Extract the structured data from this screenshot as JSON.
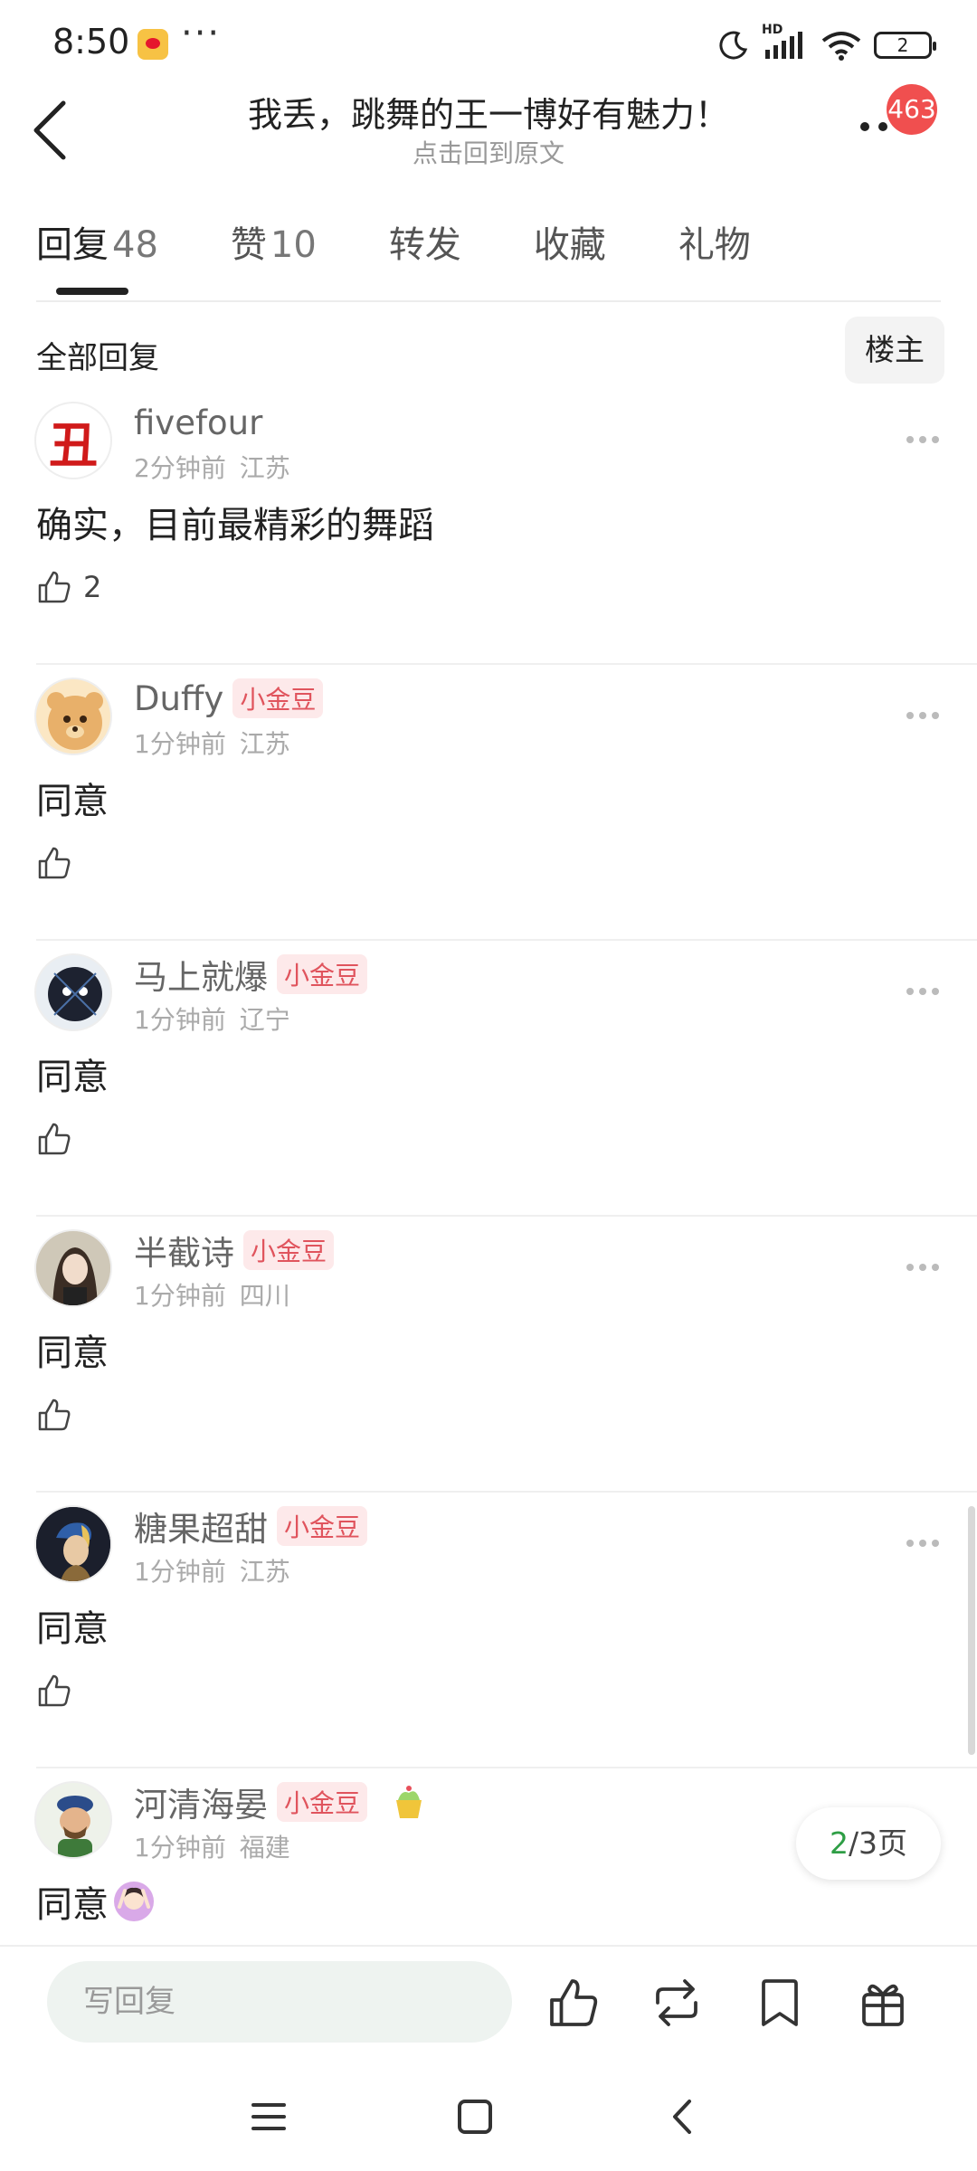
{
  "status_bar": {
    "time": "8:50",
    "more": "···",
    "battery_level": "2",
    "network": "HD"
  },
  "header": {
    "title": "我丢，跳舞的王一博好有魅力！",
    "subtitle": "点击回到原文",
    "notification_count": "463"
  },
  "tabs": [
    {
      "label": "回复",
      "count": "48",
      "active": true
    },
    {
      "label": "赞",
      "count": "10",
      "active": false
    },
    {
      "label": "转发",
      "count": "",
      "active": false
    },
    {
      "label": "收藏",
      "count": "",
      "active": false
    },
    {
      "label": "礼物",
      "count": "",
      "active": false
    }
  ],
  "filter": {
    "label": "全部回复",
    "owner_button": "楼主"
  },
  "comments": [
    {
      "user": "fivefour",
      "badge": "",
      "time": "2分钟前",
      "location": "江苏",
      "text": "确实，目前最精彩的舞蹈",
      "likes": "2",
      "avatar": "char-avatar"
    },
    {
      "user": "Duffy",
      "badge": "小金豆",
      "time": "1分钟前",
      "location": "江苏",
      "text": "同意",
      "likes": "",
      "avatar": "bear-avatar"
    },
    {
      "user": "马上就爆",
      "badge": "小金豆",
      "time": "1分钟前",
      "location": "辽宁",
      "text": "同意",
      "likes": "",
      "avatar": "dark-avatar"
    },
    {
      "user": "半截诗",
      "badge": "小金豆",
      "time": "1分钟前",
      "location": "四川",
      "text": "同意",
      "likes": "",
      "avatar": "portrait-avatar"
    },
    {
      "user": "糖果超甜",
      "badge": "小金豆",
      "time": "1分钟前",
      "location": "江苏",
      "text": "同意",
      "likes": "",
      "avatar": "painting-avatar"
    },
    {
      "user": "河清海晏",
      "badge": "小金豆",
      "time": "1分钟前",
      "location": "福建",
      "text": "同意",
      "likes": "",
      "avatar": "figure-avatar"
    }
  ],
  "char_avatar_text": "丑",
  "pagination": {
    "current": "2",
    "total": "/3页"
  },
  "bottom_bar": {
    "reply_placeholder": "写回复"
  },
  "colors": {
    "accent_green": "#2e9e45",
    "badge_red": "#e0545d",
    "notif_red": "#f04f4f"
  }
}
